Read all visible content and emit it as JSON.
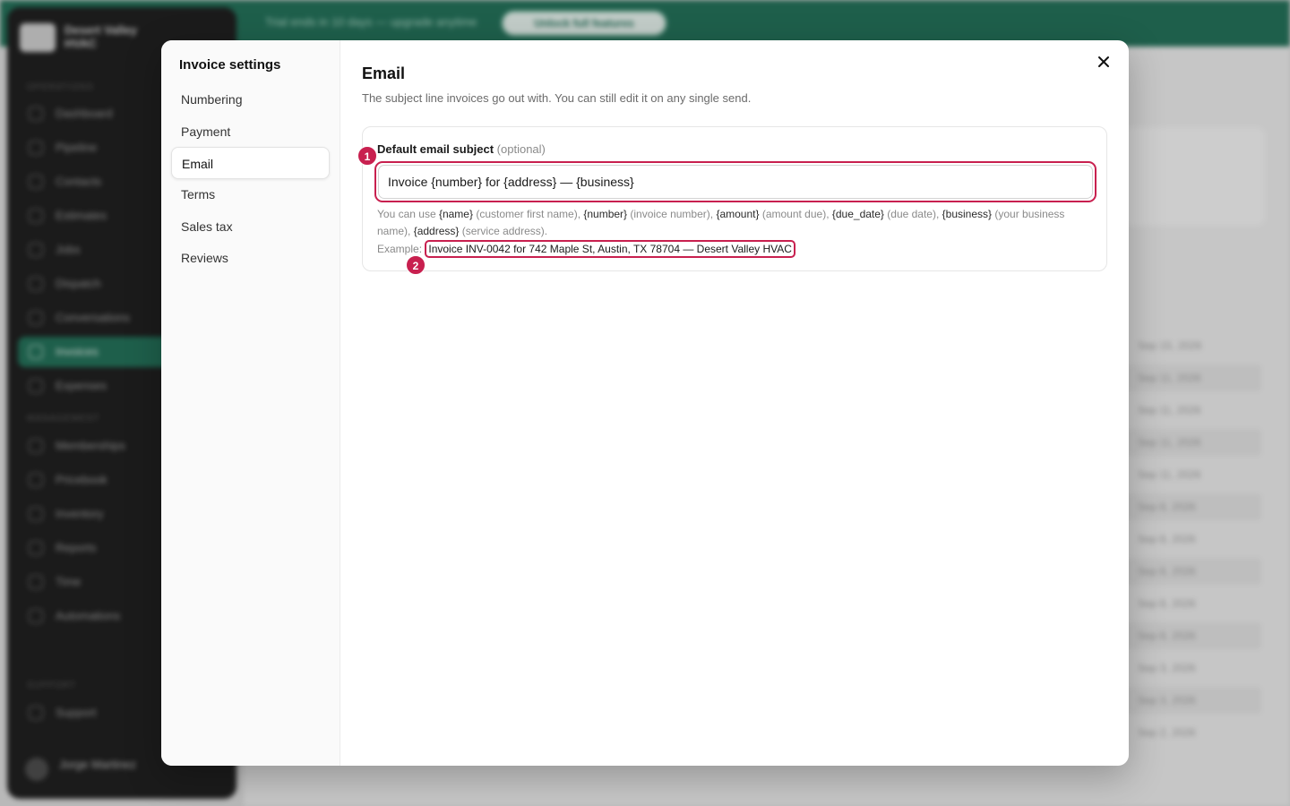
{
  "background": {
    "banner_text": "Trial ends in 10 days — upgrade anytime",
    "banner_button": "Unlock full features",
    "brand": "Desert Valley HVAC",
    "section_operations": "OPERATIONS",
    "section_management": "MANAGEMENT",
    "section_support": "SUPPORT",
    "nav": [
      "Dashboard",
      "Pipeline",
      "Contacts",
      "Estimates",
      "Jobs",
      "Dispatch",
      "Conversations",
      "Invoices",
      "Expenses"
    ],
    "nav_mgmt": [
      "Memberships",
      "Pricebook",
      "Inventory",
      "Reports",
      "Time",
      "Automations"
    ],
    "nav_support": [
      "Support"
    ],
    "user": "Jorge Martinez",
    "rows": [
      "Sep 15, 2026",
      "Sep 11, 2026",
      "Sep 11, 2026",
      "Sep 11, 2026",
      "Sep 11, 2026",
      "Sep 8, 2026",
      "Sep 8, 2026",
      "Sep 8, 2026",
      "Sep 8, 2026",
      "Sep 8, 2026",
      "Sep 3, 2026",
      "Sep 3, 2026",
      "Sep 2, 2026"
    ]
  },
  "modal": {
    "title": "Invoice settings",
    "nav_items": [
      "Numbering",
      "Payment",
      "Email",
      "Terms",
      "Sales tax",
      "Reviews"
    ],
    "active_index": 2,
    "close_icon": "close-icon"
  },
  "email_section": {
    "title": "Email",
    "description": "The subject line invoices go out with. You can still edit it on any single send.",
    "field_label": "Default email subject",
    "field_optional": "(optional)",
    "subject_value": "Invoice {number} for {address} — {business}",
    "help": {
      "lead": "You can use ",
      "tokens": [
        {
          "token": "{name}",
          "desc": " (customer first name), "
        },
        {
          "token": "{number}",
          "desc": " (invoice number), "
        },
        {
          "token": "{amount}",
          "desc": " (amount due), "
        },
        {
          "token": "{due_date}",
          "desc": " (due date), "
        },
        {
          "token": "{business}",
          "desc": " (your business name), "
        },
        {
          "token": "{address}",
          "desc": " (service address)."
        }
      ]
    },
    "example_label": "Example:",
    "example_value": "Invoice INV-0042 for 742 Maple St, Austin, TX 78704 — Desert Valley HVAC"
  },
  "markers": [
    "1",
    "2"
  ],
  "colors": {
    "accent_highlight": "#c8204f",
    "brand_green": "#1f6e56"
  }
}
